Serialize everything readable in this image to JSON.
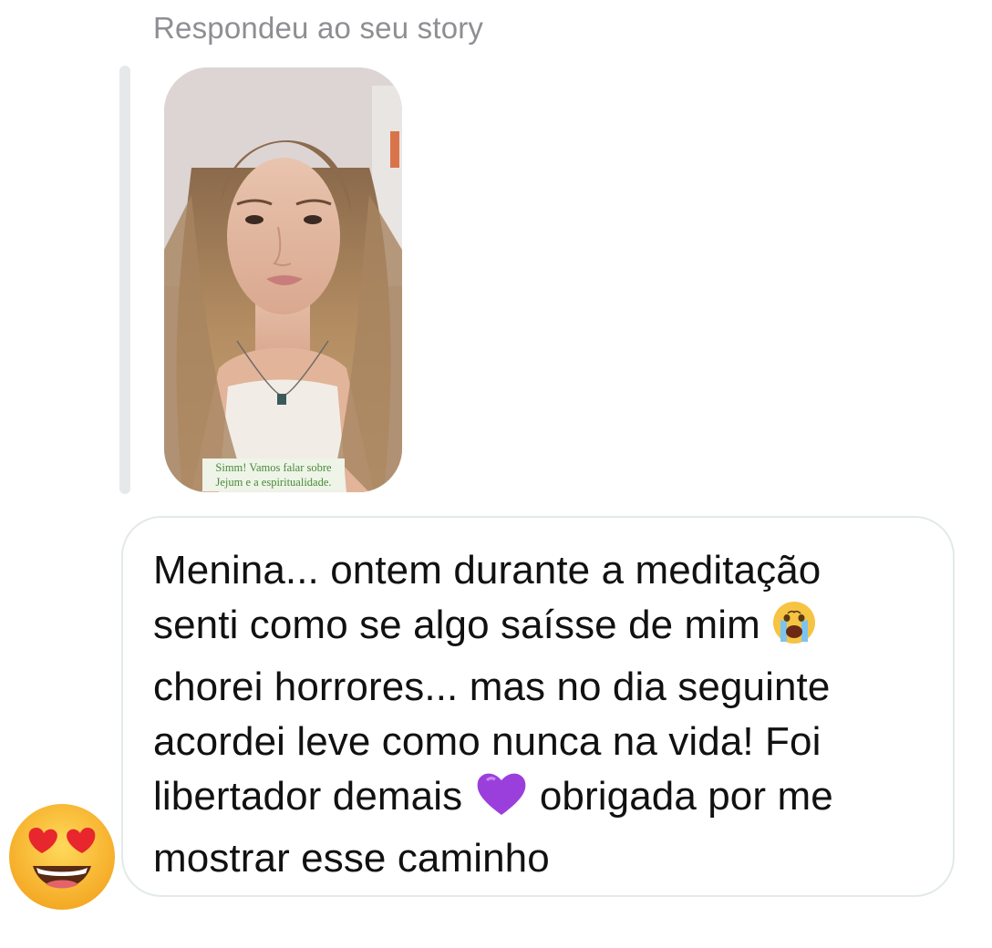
{
  "reply": {
    "header": "Respondeu ao seu story",
    "story_caption_line1": "Simm! Vamos falar sobre",
    "story_caption_line2": "Jejum e a espiritualidade."
  },
  "message": {
    "line1": "Menina... ontem durante a meditação",
    "line2": "senti como se algo saísse de mim",
    "line2_emoji": "crying-face",
    "line3": "chorei horrores... mas no dia seguinte",
    "line4": "acordei leve como nunca na vida! Foi",
    "line5a": "libertador demais",
    "line5_emoji": "purple-heart",
    "line5b": "obrigada por me",
    "line6": "mostrar esse caminho"
  },
  "reaction": {
    "emoji": "heart-eyes-face"
  },
  "colors": {
    "caption_text": "#4b8a3a",
    "caption_bg": "#eef4e8",
    "header_text": "#8e8e93",
    "bubble_border": "#e2eae6",
    "reply_bar": "#e6e8ea"
  }
}
